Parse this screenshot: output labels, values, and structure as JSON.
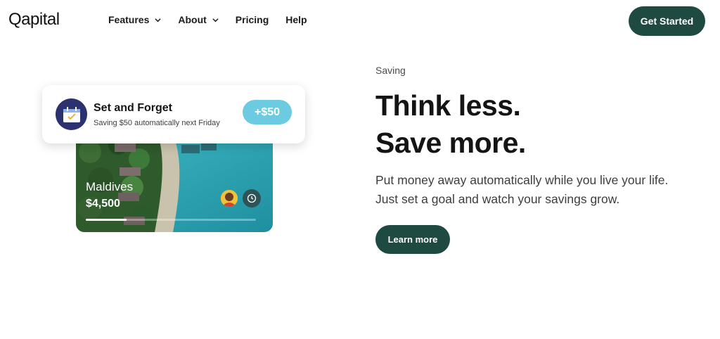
{
  "header": {
    "logo": "Qapital",
    "nav": [
      {
        "label": "Features",
        "dropdown": true
      },
      {
        "label": "About",
        "dropdown": true
      },
      {
        "label": "Pricing",
        "dropdown": false
      },
      {
        "label": "Help",
        "dropdown": false
      }
    ],
    "cta_label": "Get Started"
  },
  "hero": {
    "eyebrow": "Saving",
    "headline_line1": "Think less.",
    "headline_line2": "Save more.",
    "description_line1": "Put money away automatically while you live your life.",
    "description_line2": "Just set a goal and watch your savings grow.",
    "button_label": "Learn more"
  },
  "notification": {
    "title": "Set and Forget",
    "subtitle": "Saving $50 automatically next Friday",
    "amount": "+$50",
    "icon": "calendar-check-icon"
  },
  "goal_card": {
    "destination": "Maldives",
    "amount": "$4,500",
    "progress_fraction": 0.24,
    "icons": [
      "avatar",
      "clock-icon"
    ]
  },
  "colors": {
    "brand_dark_green": "#1f4a42",
    "accent_cyan": "#6ccbe0",
    "icon_navy": "#2c3170"
  }
}
